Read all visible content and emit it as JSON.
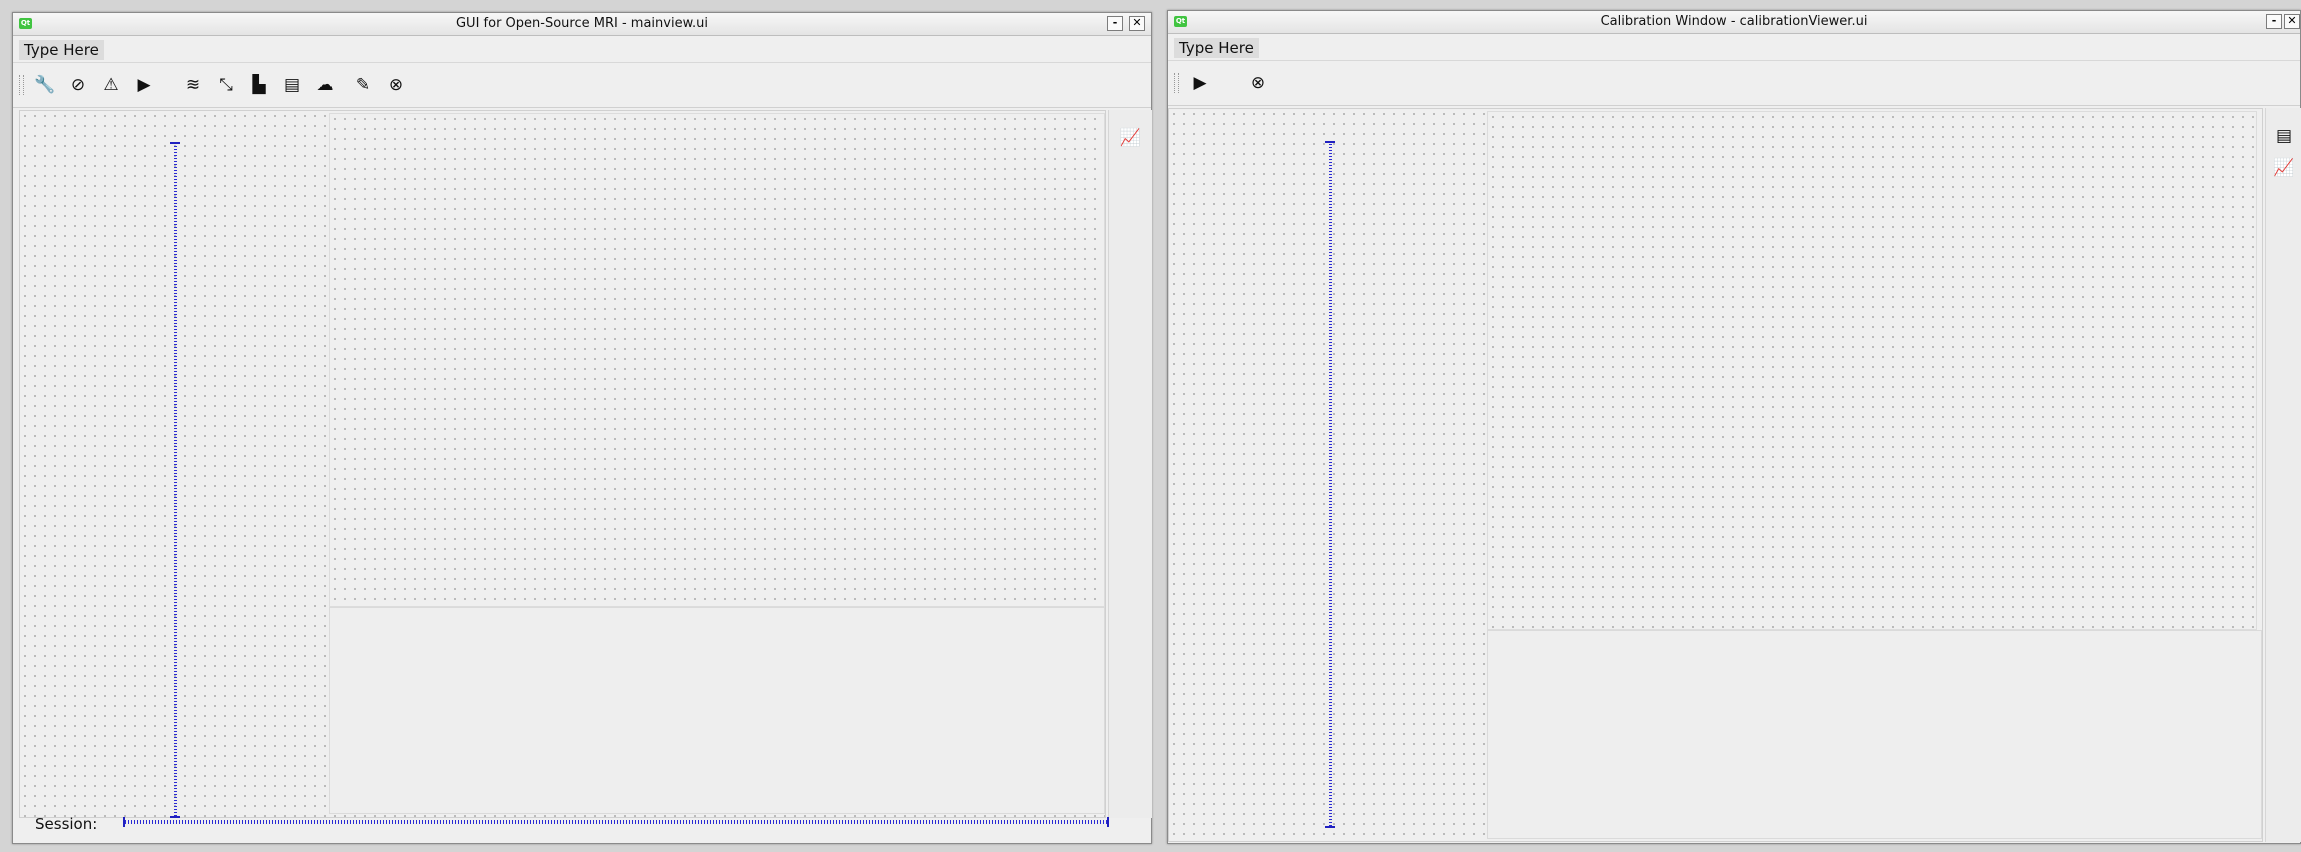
{
  "main_window": {
    "title": "GUI for Open-Source MRI - mainview.ui",
    "app_icon_text": "Qt",
    "minimize_label": "-",
    "close_label": "✕",
    "menu": {
      "type_here": "Type Here"
    },
    "toolbar": {
      "icons": [
        "wrench-icon",
        "compass-icon",
        "mail-upload-icon",
        "play-icon",
        "waves-icon",
        "compress-icon",
        "bar-chart-icon",
        "id-card-icon",
        "cloud-icon",
        "pen-icon",
        "cancel-circle-icon"
      ],
      "glyphs": [
        "🔧",
        "⊘",
        "⚠",
        "▶",
        "≋",
        "⤡",
        "▙",
        "▤",
        "☁",
        "✎",
        "⊗"
      ]
    },
    "dock": {
      "icons": [
        "line-chart-icon"
      ],
      "glyphs": [
        "📈"
      ]
    },
    "session_label": "Session:"
  },
  "calibration_window": {
    "title": "Calibration Window - calibrationViewer.ui",
    "app_icon_text": "Qt",
    "minimize_label": "-",
    "close_label": "✕",
    "menu": {
      "type_here": "Type Here"
    },
    "toolbar": {
      "icons": [
        "play-icon",
        "cancel-circle-icon"
      ],
      "glyphs": [
        "▶",
        "⊗"
      ]
    },
    "dock": {
      "icons": [
        "clipboard-icon",
        "line-chart-icon"
      ],
      "glyphs": [
        "▤",
        "📈"
      ]
    }
  },
  "colors": {
    "spacer": "#2020c0",
    "app_icon": "#41c441"
  }
}
